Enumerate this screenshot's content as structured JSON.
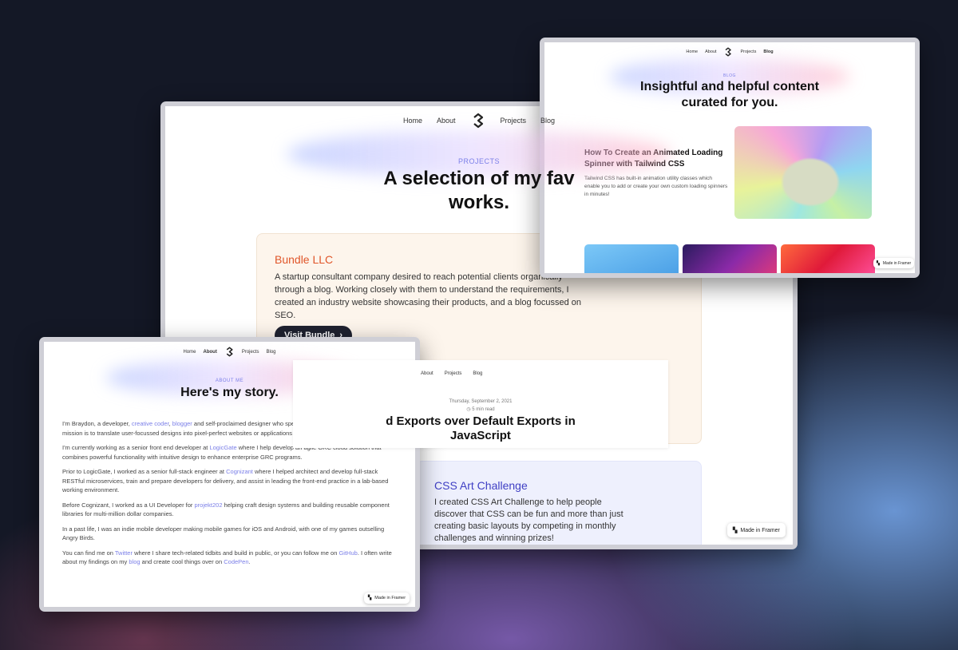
{
  "projects_page": {
    "nav": {
      "home": "Home",
      "about": "About",
      "projects": "Projects",
      "blog": "Blog"
    },
    "eyebrow": "PROJECTS",
    "title_line1": "A selection of my fav",
    "title_line2": "works.",
    "project1": {
      "name": "Bundle LLC",
      "description": "A startup consultant company desired to reach potential clients organically through a blog. Working closely with them to understand the requirements, I created an industry website showcasing their products, and a blog focussed on SEO.",
      "button_label": "Visit Bundle",
      "accent_color": "#e0562a"
    },
    "project2": {
      "name": "CSS Art Challenge",
      "description": "I created CSS Art Challenge to help people discover that CSS can be fun and more than just creating basic layouts by competing in monthly challenges and winning prizes!",
      "accent_color": "#3f3fc4"
    },
    "badge": "Made in Framer"
  },
  "article_page": {
    "nav": {
      "about": "About",
      "projects": "Projects",
      "blog": "Blog"
    },
    "date": "Thursday, September 2, 2021",
    "read_time": "5 min read",
    "title_line1": "d Exports over Default Exports in",
    "title_line2": "JavaScript"
  },
  "blog_page": {
    "nav": {
      "home": "Home",
      "about": "About",
      "projects": "Projects",
      "blog": "Blog"
    },
    "eyebrow": "BLOG",
    "title_line1": "Insightful and helpful content",
    "title_line2": "curated for you.",
    "featured": {
      "title": "How To Create an Animated Loading Spinner with Tailwind CSS",
      "excerpt": "Tailwind CSS has built-in animation utility classes which enable you to add or create your own custom loading spinners in minutes!"
    },
    "badge": "Made in Framer"
  },
  "about_page": {
    "nav": {
      "home": "Home",
      "about": "About",
      "projects": "Projects",
      "blog": "Blog"
    },
    "eyebrow": "ABOUT ME",
    "title": "Here's my story.",
    "p1": {
      "a": "I'm Braydon, a developer, ",
      "l1": "creative coder",
      "b": ", ",
      "l2": "blogger",
      "c": " and self-proclaimed designer who specializes in front-end development. My mission is to translate user-focussed designs into pixel-perfect websites or applications that run blazing fast."
    },
    "p2": {
      "a": "I'm currently working as a senior front end developer at ",
      "l1": "LogicGate",
      "b": " where I help develop an agile GRC cloud solution that combines powerful functionality with intuitive design to enhance enterprise GRC programs."
    },
    "p3": {
      "a": "Prior to LogicGate, I worked as a senior full-stack engineer at ",
      "l1": "Cognizant",
      "b": " where I helped architect and develop full-stack RESTful microservices, train and prepare developers for delivery, and assist in leading the front-end practice in a lab-based working environment."
    },
    "p4": {
      "a": "Before Cognizant, I worked as a UI Developer for ",
      "l1": "projekt202",
      "b": " helping craft design systems and building reusable component libraries for multi-million dollar companies."
    },
    "p5": "In a past life, I was an indie mobile developer making mobile games for iOS and Android, with one of my games outselling Angry Birds.",
    "p6": {
      "a": "You can find me on ",
      "l1": "Twitter",
      "b": " where I share tech-related tidbits and build in public, or you can follow me on ",
      "l2": "GitHub",
      "c": ". I often write about my findings on my ",
      "l3": "blog",
      "d": " and create cool things over on ",
      "l4": "CodePen",
      "e": "."
    },
    "badge": "Made in Framer"
  },
  "colors": {
    "link": "#7b7fe8",
    "background": "#141826",
    "frame": "#cfcfd6"
  },
  "icons": [
    "logo-icon",
    "chevron-right-icon",
    "clock-icon",
    "framer-icon"
  ]
}
